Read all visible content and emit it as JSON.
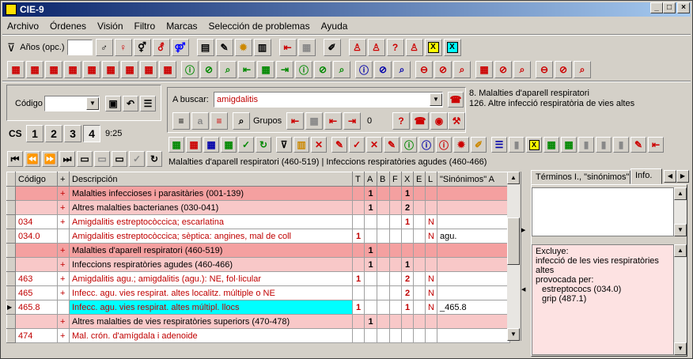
{
  "window": {
    "title": "CIE-9"
  },
  "menu": [
    "Archivo",
    "Órdenes",
    "Visión",
    "Filtro",
    "Marcas",
    "Selección de problemas",
    "Ayuda"
  ],
  "toolbar": {
    "years_label": "Años (opc.)",
    "years_value": ""
  },
  "codigo": {
    "label": "Código",
    "value": ""
  },
  "search": {
    "label": "A buscar:",
    "value": "amigdalitis",
    "groups_label": "Grupos",
    "count": "0"
  },
  "result": {
    "line1": "8. Malalties d'aparell respiratori",
    "line2": "126. Altre infecció respiratòria de vies altes"
  },
  "levels": {
    "cs": "CS",
    "l1": "1",
    "l2": "2",
    "l3": "3",
    "l4": "4",
    "time": "9:25"
  },
  "breadcrumb": "Malalties d'aparell respiratori (460-519) | Infeccions respiratòries agudes (460-466)",
  "columns": [
    "Código",
    "+",
    "Descripción",
    "T",
    "A",
    "B",
    "F",
    "X",
    "E",
    "L",
    "\"Sinónimos\" A"
  ],
  "rows": [
    {
      "code": "",
      "plus": "+",
      "desc": "Malalties infeccioses i parasitàries (001-139)",
      "t": "",
      "a": "1",
      "b": "",
      "f": "",
      "x": "1",
      "e": "",
      "l": "",
      "syn": "",
      "bg": "#f4a0a0"
    },
    {
      "code": "",
      "plus": "+",
      "desc": "Altres malalties bacterianes (030-041)",
      "t": "",
      "a": "1",
      "b": "",
      "f": "",
      "x": "2",
      "e": "",
      "l": "",
      "syn": "",
      "bg": "#f8c8c8"
    },
    {
      "code": "034",
      "plus": "+",
      "desc": "Amigdalitis estreptocòccica; escarlatina",
      "t": "",
      "a": "",
      "b": "",
      "f": "",
      "x": "1",
      "e": "",
      "l": "N",
      "syn": "",
      "bg": "#ffffff"
    },
    {
      "code": "034.0",
      "plus": "",
      "desc": "Amigdalitis estreptocòccica; sèptica: angines, mal de coll",
      "t": "1",
      "a": "",
      "b": "",
      "f": "",
      "x": "",
      "e": "",
      "l": "N",
      "syn": "agu.",
      "bg": "#ffffff"
    },
    {
      "code": "",
      "plus": "+",
      "desc": "Malalties d'aparell respiratori (460-519)",
      "t": "",
      "a": "1",
      "b": "",
      "f": "",
      "x": "",
      "e": "",
      "l": "",
      "syn": "",
      "bg": "#f4a0a0"
    },
    {
      "code": "",
      "plus": "+",
      "desc": "Infeccions respiratòries agudes (460-466)",
      "t": "",
      "a": "1",
      "b": "",
      "f": "",
      "x": "1",
      "e": "",
      "l": "",
      "syn": "",
      "bg": "#f8c8c8"
    },
    {
      "code": "463",
      "plus": "+",
      "desc": "Amigdalitis agu.; amigdalitis (agu.): NE, fol·licular",
      "t": "1",
      "a": "",
      "b": "",
      "f": "",
      "x": "2",
      "e": "",
      "l": "N",
      "syn": "",
      "bg": "#ffffff"
    },
    {
      "code": "465",
      "plus": "+",
      "desc": "Infecc. agu. vies respirat. altes localitz. múltiple o NE",
      "t": "",
      "a": "",
      "b": "",
      "f": "",
      "x": "2",
      "e": "",
      "l": "N",
      "syn": "",
      "bg": "#ffffff"
    },
    {
      "code": "465.8",
      "plus": "",
      "desc": "Infecc. agu. vies respirat. altes múltipl. llocs",
      "t": "1",
      "a": "",
      "b": "",
      "f": "",
      "x": "1",
      "e": "",
      "l": "N",
      "syn": "_465.8",
      "bg": "#ffffff",
      "sel": true
    },
    {
      "code": "",
      "plus": "+",
      "desc": "Altres malalties de vies respiratòries superiors (470-478)",
      "t": "",
      "a": "1",
      "b": "",
      "f": "",
      "x": "",
      "e": "",
      "l": "",
      "syn": "",
      "bg": "#f8c8c8"
    },
    {
      "code": "474",
      "plus": "+",
      "desc": "Mal. crón. d'amígdala i adenoide",
      "t": "",
      "a": "",
      "b": "",
      "f": "",
      "x": "",
      "e": "",
      "l": "",
      "syn": "",
      "bg": "#ffffff"
    }
  ],
  "tabs": {
    "t1": "Términos I., \"sinónimos\"",
    "t2": "Info."
  },
  "info": {
    "title": "Excluye:",
    "lines": [
      "infecció de les vies respiratòries altes",
      "provocada per:",
      "  estreptococs (034.0)",
      "  grip (487.1)"
    ]
  }
}
